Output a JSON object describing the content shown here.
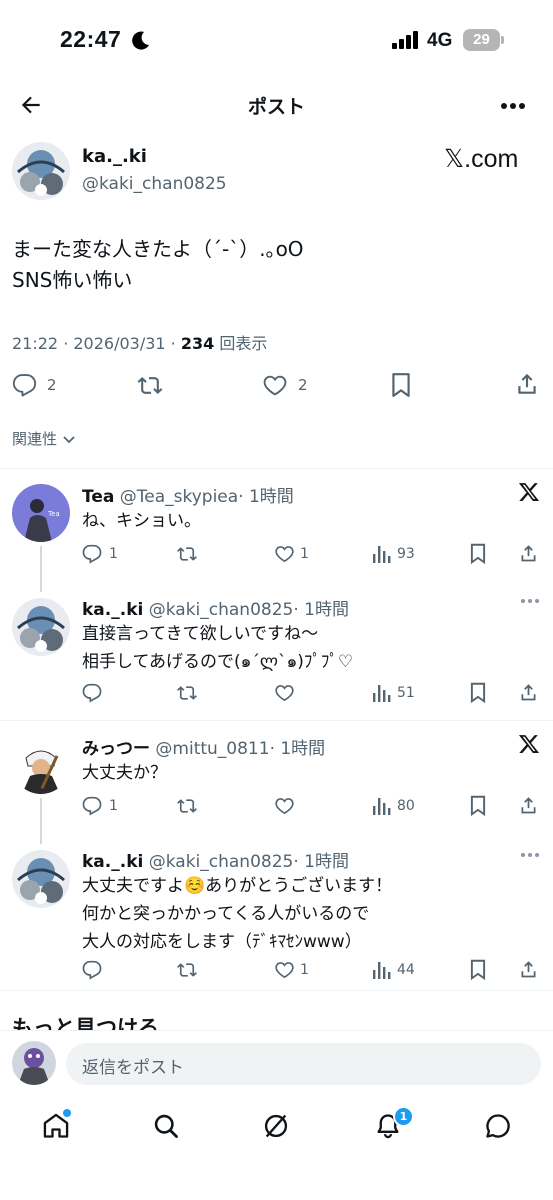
{
  "status": {
    "time": "22:47",
    "network": "4G",
    "battery": "29"
  },
  "header": {
    "title": "ポスト"
  },
  "post": {
    "name": "ka._.ki",
    "handle": "@kaki_chan0825",
    "source": "𝕏.com",
    "text_line1": "まーた変な人きたよ（´-`）.｡oO",
    "text_line2": "SNS怖い怖い",
    "time": "21:22 · 2026/03/31 · ",
    "views": "234",
    "views_label": " 回表示",
    "replies": "2",
    "likes": "2"
  },
  "related_label": "関連性",
  "replies": [
    {
      "name": "Tea",
      "handle": "@Tea_skypiea",
      "time": "· 1時間",
      "lines": [
        "ね、キショい。"
      ],
      "reply_count": "1",
      "like_count": "1",
      "views": "93"
    },
    {
      "name": "ka._.ki",
      "handle": "@kaki_chan0825",
      "time": "· 1時間",
      "lines": [
        "直接言ってきて欲しいですね〜",
        "相手してあげるので(๑´ლ`๑)ﾌﾟﾌﾟ♡"
      ],
      "reply_count": "",
      "like_count": "",
      "views": "51"
    },
    {
      "name": "みっつー",
      "handle": "@mittu_0811",
      "time": "· 1時間",
      "lines": [
        "大丈夫か？"
      ],
      "reply_count": "1",
      "like_count": "",
      "views": "80"
    },
    {
      "name": "ka._.ki",
      "handle": "@kaki_chan0825",
      "time": "· 1時間",
      "lines": [
        "大丈夫ですよ☺️ありがとうございます！",
        "何かと突っかかってくる人がいるので",
        "大人の対応をします（ﾃﾞｷﾏｾﾝwww）"
      ],
      "reply_count": "",
      "like_count": "1",
      "views": "44"
    }
  ],
  "more_section": "もっと見つける",
  "reply_placeholder": "返信をポスト",
  "nav": {
    "notifications_badge": "1"
  },
  "colors": {
    "accent": "#1d9bf0",
    "muted": "#536471",
    "text": "#0f1419"
  }
}
